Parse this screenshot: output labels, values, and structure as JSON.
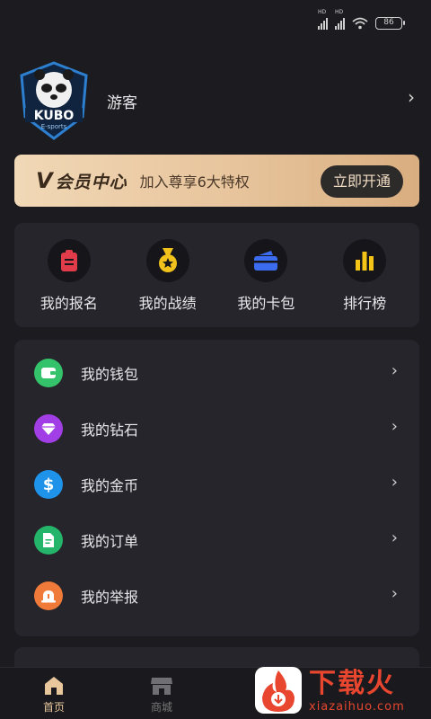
{
  "status_bar": {
    "battery": "86",
    "hd1": "HD",
    "hd2": "HD"
  },
  "profile": {
    "username": "游客",
    "avatar_text": "KUBO",
    "avatar_sub": "E-sports"
  },
  "vip": {
    "logo_prefix": "V",
    "logo": "会员中心",
    "desc": "加入尊享6大特权",
    "button": "立即开通"
  },
  "quick": [
    {
      "label": "我的报名",
      "icon": "clipboard-icon",
      "color": "#e23c4a"
    },
    {
      "label": "我的战绩",
      "icon": "medal-icon",
      "color": "#f1c21b"
    },
    {
      "label": "我的卡包",
      "icon": "card-wallet-icon",
      "color": "#3b6cf0"
    },
    {
      "label": "排行榜",
      "icon": "bar-chart-icon",
      "color": "#f4c417"
    }
  ],
  "menu": [
    {
      "label": "我的钱包",
      "icon": "wallet-icon",
      "color": "#34c36a"
    },
    {
      "label": "我的钻石",
      "icon": "diamond-icon",
      "color": "#a23ee6"
    },
    {
      "label": "我的金币",
      "icon": "dollar-icon",
      "color": "#1f93ea"
    },
    {
      "label": "我的订单",
      "icon": "document-icon",
      "color": "#25b56a"
    },
    {
      "label": "我的举报",
      "icon": "alarm-icon",
      "color": "#f07a3a"
    }
  ],
  "tabs": [
    {
      "label": "首页",
      "icon": "home-icon"
    },
    {
      "label": "商城",
      "icon": "store-icon"
    }
  ],
  "watermark": {
    "cn": "下载火",
    "en": "xiazaihuo.com"
  }
}
